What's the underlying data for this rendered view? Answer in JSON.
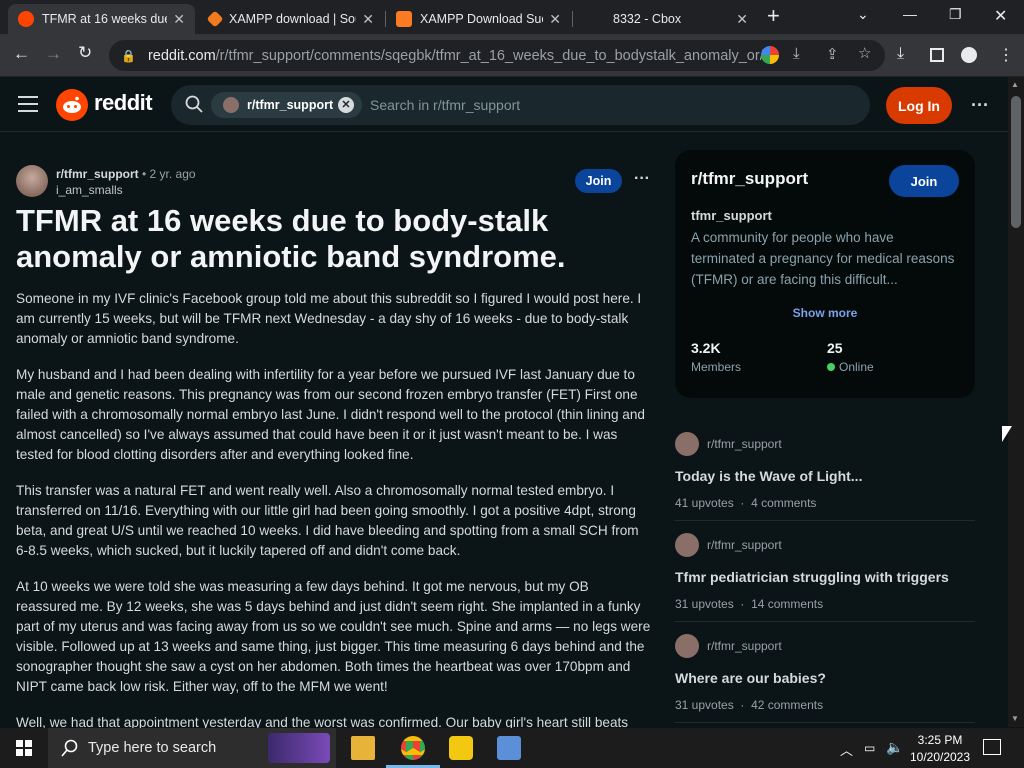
{
  "browser": {
    "tabs": [
      {
        "title": "TFMR at 16 weeks due",
        "active": true
      },
      {
        "title": "XAMPP download | Sou",
        "active": false
      },
      {
        "title": "XAMPP Download Succ",
        "active": false
      },
      {
        "title": "8332 - Cbox",
        "active": false
      }
    ],
    "new_tab_label": "+",
    "url_host": "reddit.com",
    "url_path": "/r/tfmr_support/comments/sqegbk/tfmr_at_16_weeks_due_to_bodystalk_anomaly_or/"
  },
  "reddit": {
    "logo_text": "reddit",
    "search_chip": "r/tfmr_support",
    "search_placeholder": "Search in r/tfmr_support",
    "login_label": "Log In"
  },
  "post": {
    "subreddit": "r/tfmr_support",
    "age": "• 2 yr. ago",
    "author": "i_am_smalls",
    "join_label": "Join",
    "title": "TFMR at 16 weeks due to body-stalk anomaly or amniotic band syndrome.",
    "paragraphs": [
      "Someone in my IVF clinic's Facebook group told me about this subreddit so I figured I would post here. I am currently 15 weeks, but will be TFMR next Wednesday - a day shy of 16 weeks - due to body-stalk anomaly or amniotic band syndrome.",
      "My husband and I had been dealing with infertility for a year before we pursued IVF last January due to male and genetic reasons. This pregnancy was from our second frozen embryo transfer (FET) First one failed with a chromosomally normal embryo last June. I didn't respond well to the protocol (thin lining and almost cancelled) so I've always assumed that could have been it or it just wasn't meant to be. I was tested for blood clotting disorders after and everything looked fine.",
      "This transfer was a natural FET and went really well. Also a chromosomally normal tested embryo. I transferred on 11/16. Everything with our little girl had been going smoothly. I got a positive 4dpt, strong beta, and great U/S until we reached 10 weeks. I did have bleeding and spotting from a small SCH from 6-8.5 weeks, which sucked, but it luckily tapered off and didn't come back.",
      "At 10 weeks we were told she was measuring a few days behind. It got me nervous, but my OB reassured me. By 12 weeks, she was 5 days behind and just didn't seem right. She implanted in a funky part of my uterus and was facing away from us so we couldn't see much. Spine and arms — no legs were visible. Followed up at 13 weeks and same thing, just bigger. This time measuring 6 days behind and the sonographer thought she saw a cyst on her abdomen. Both times the heartbeat was over 170bpm and NIPT came back low risk. Either way, off to the MFM we went!",
      "Well, we had that appointment yesterday and the worst was confirmed. Our baby girl's heart still beats"
    ]
  },
  "sidebar": {
    "name": "r/tfmr_support",
    "join_label": "Join",
    "community_title": "tfmr_support",
    "description": "A community for people who have terminated a pregnancy for medical reasons (TFMR) or are facing this difficult...",
    "show_more": "Show more",
    "members_value": "3.2K",
    "members_label": "Members",
    "online_value": "25",
    "online_label": "Online"
  },
  "related": [
    {
      "subreddit": "r/tfmr_support",
      "title": "Today is the Wave of Light...",
      "upvotes": "41 upvotes",
      "comments": "4 comments"
    },
    {
      "subreddit": "r/tfmr_support",
      "title": "Tfmr pediatrician struggling with triggers",
      "upvotes": "31 upvotes",
      "comments": "14 comments"
    },
    {
      "subreddit": "r/tfmr_support",
      "title": "Where are our babies?",
      "upvotes": "31 upvotes",
      "comments": "42 comments"
    }
  ],
  "taskbar": {
    "search_placeholder": "Type here to search",
    "time": "3:25 PM",
    "date": "10/20/2023"
  },
  "colors": {
    "reddit_orange": "#ff4500",
    "login_button": "#d93a00",
    "join_button": "#0a449b",
    "online_dot": "#46d160"
  }
}
